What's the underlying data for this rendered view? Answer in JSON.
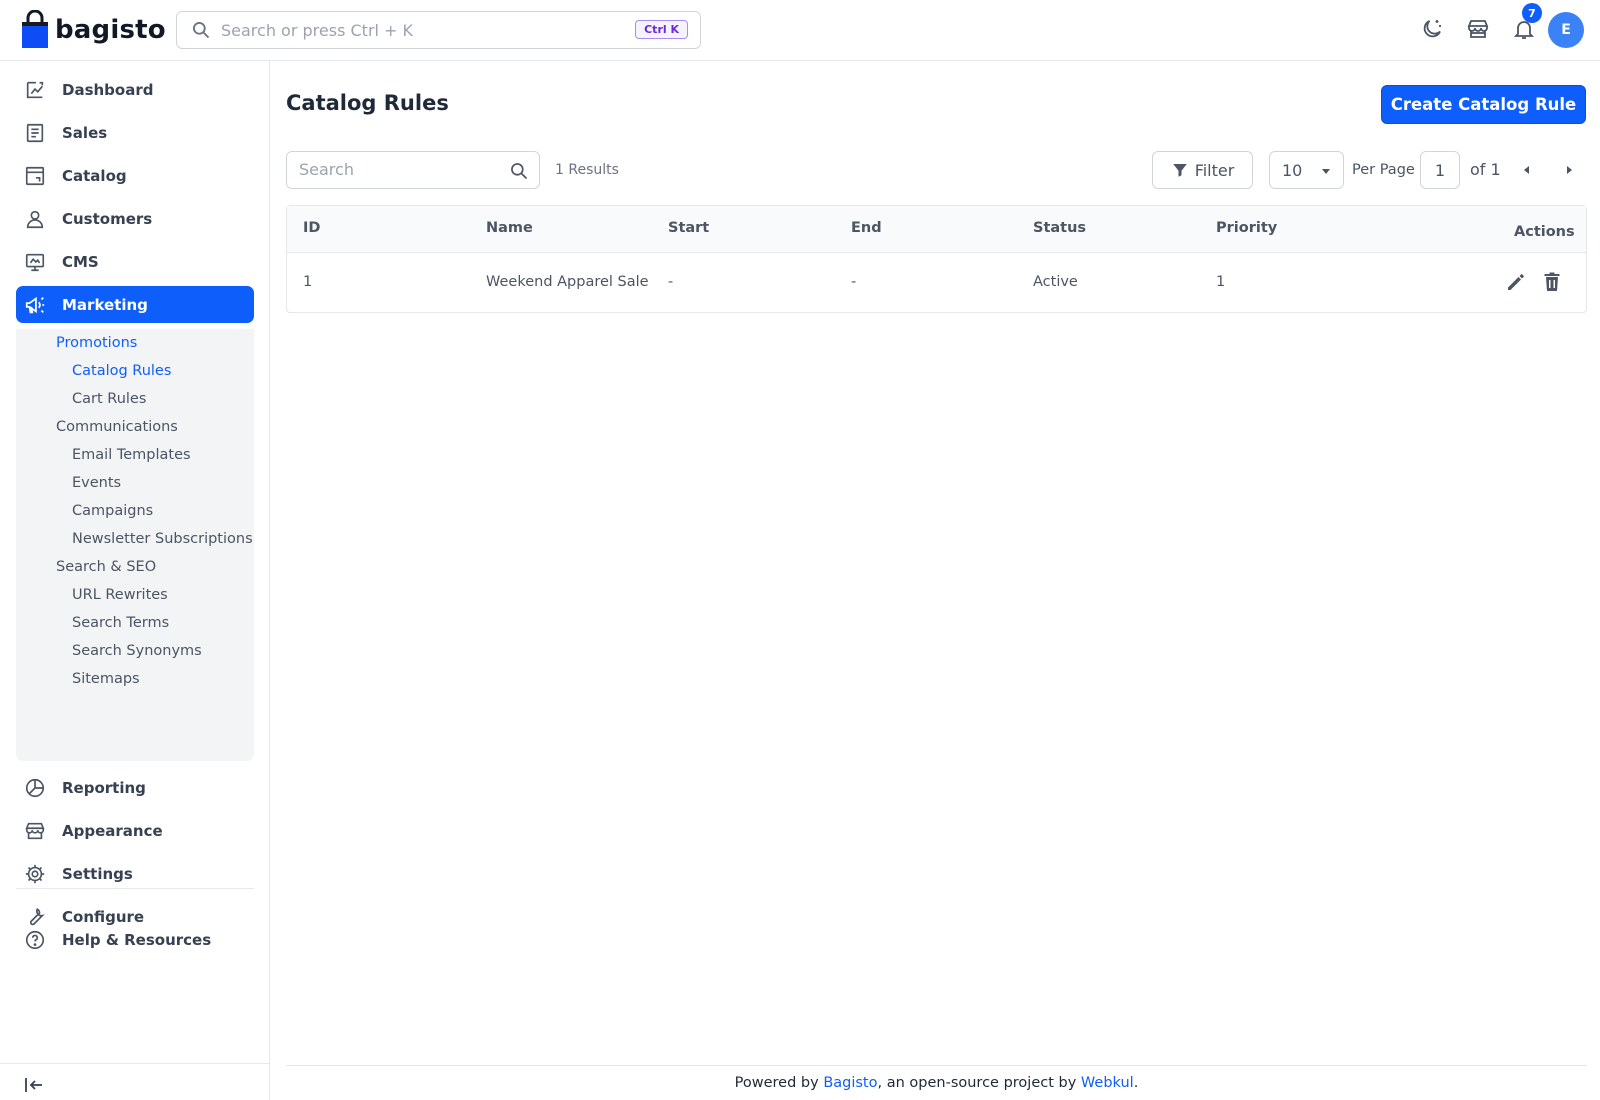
{
  "header": {
    "logo_text": "bagisto",
    "search_placeholder": "Search or press Ctrl + K",
    "shortcut": "Ctrl K",
    "notification_count": "7",
    "avatar_initial": "E"
  },
  "sidebar": {
    "items": [
      {
        "label": "Dashboard",
        "icon": "dashboard-icon"
      },
      {
        "label": "Sales",
        "icon": "sales-icon"
      },
      {
        "label": "Catalog",
        "icon": "catalog-icon"
      },
      {
        "label": "Customers",
        "icon": "customers-icon"
      },
      {
        "label": "CMS",
        "icon": "cms-icon"
      },
      {
        "label": "Marketing",
        "icon": "marketing-icon",
        "active": true
      },
      {
        "label": "Reporting",
        "icon": "reporting-icon"
      },
      {
        "label": "Appearance",
        "icon": "appearance-icon"
      },
      {
        "label": "Settings",
        "icon": "settings-icon"
      },
      {
        "label": "Configure",
        "icon": "configure-icon"
      }
    ],
    "marketing_sub": {
      "promotions": "Promotions",
      "catalog_rules": "Catalog Rules",
      "cart_rules": "Cart Rules",
      "communications": "Communications",
      "email_templates": "Email Templates",
      "events": "Events",
      "campaigns": "Campaigns",
      "newsletter_subscriptions": "Newsletter Subscriptions",
      "search_seo": "Search & SEO",
      "url_rewrites": "URL Rewrites",
      "search_terms": "Search Terms",
      "search_synonyms": "Search Synonyms",
      "sitemaps": "Sitemaps"
    },
    "help": "Help & Resources"
  },
  "main": {
    "title": "Catalog Rules",
    "create_button": "Create Catalog Rule",
    "search_placeholder": "Search",
    "results": "1 Results",
    "filter_label": "Filter",
    "per_page_value": "10",
    "per_page_label": "Per Page",
    "page_number": "1",
    "page_of": "of 1",
    "columns": [
      "ID",
      "Name",
      "Start",
      "End",
      "Status",
      "Priority",
      "Actions"
    ],
    "rows": [
      {
        "id": "1",
        "name": "Weekend Apparel Sale",
        "start": "-",
        "end": "-",
        "status": "Active",
        "priority": "1"
      }
    ]
  },
  "footer": {
    "prefix": "Powered by",
    "link1": "Bagisto",
    "middle": ", an open-source project by",
    "link2": "Webkul",
    "suffix": "."
  },
  "colors": {
    "accent": "#0e5efc",
    "submenu_bg": "#f3f4f6",
    "kbd_purple": "#6d28d9"
  }
}
